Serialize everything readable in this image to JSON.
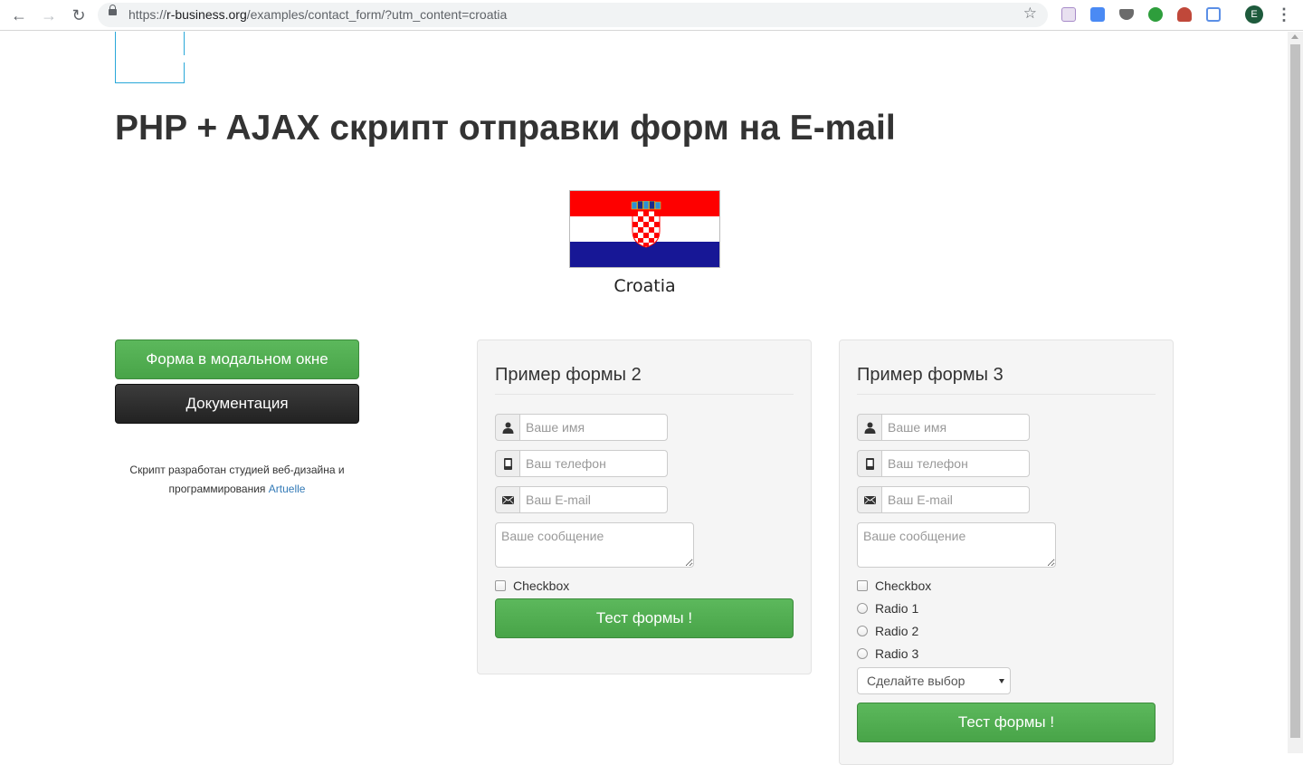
{
  "browser": {
    "url_prefix": "https://",
    "url_host": "r-business.org",
    "url_path": "/examples/contact_form/?utm_content=croatia",
    "profile_initial": "E"
  },
  "page": {
    "title": "PHP + AJAX скрипт отправки форм на E-mail",
    "country_name": "Croatia",
    "flag_colors": [
      "#FF0000",
      "#FFFFFF",
      "#171796"
    ]
  },
  "sidebar": {
    "modal_button": "Форма в модальном окне",
    "docs_button": "Документация",
    "credits_text": "Скрипт разработан студией веб-дизайна и программирования",
    "credits_link": "Artuelle"
  },
  "form2": {
    "title": "Пример формы 2",
    "name_placeholder": "Ваше имя",
    "phone_placeholder": "Ваш телефон",
    "email_placeholder": "Ваш E-mail",
    "message_placeholder": "Ваше сообщение",
    "checkbox_label": "Checkbox",
    "submit": "Тест формы !"
  },
  "form3": {
    "title": "Пример формы 3",
    "name_placeholder": "Ваше имя",
    "phone_placeholder": "Ваш телефон",
    "email_placeholder": "Ваш E-mail",
    "message_placeholder": "Ваше сообщение",
    "checkbox_label": "Checkbox",
    "radios": [
      "Radio 1",
      "Radio 2",
      "Radio 3"
    ],
    "select_value": "Сделайте выбор",
    "submit": "Тест формы !"
  },
  "colors": {
    "button_green": "#5CB85C",
    "button_dark": "#333333",
    "link": "#337AB7"
  }
}
